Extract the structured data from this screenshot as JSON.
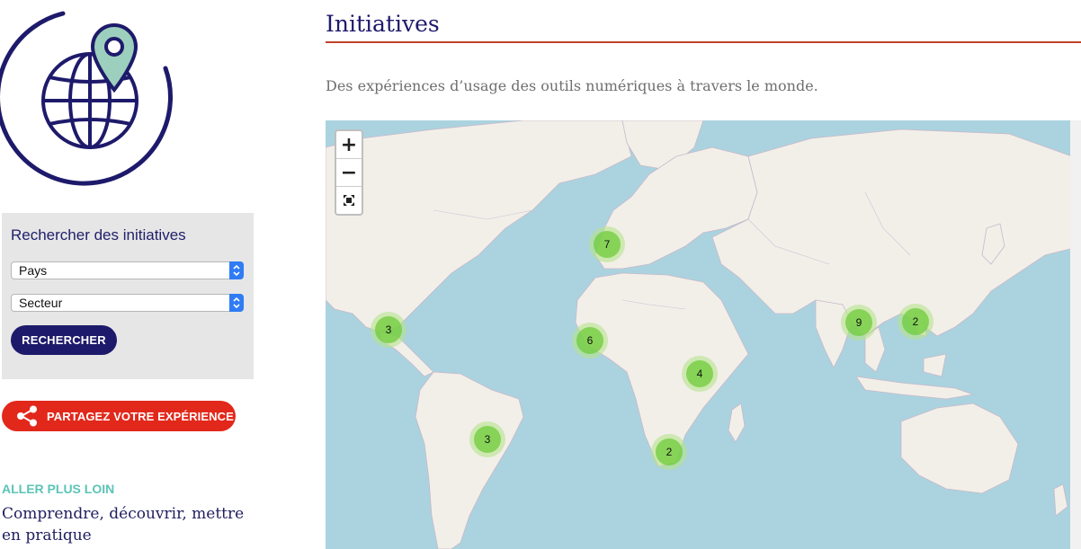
{
  "sidebar": {
    "search": {
      "title": "Rechercher des initiatives",
      "country_select": "Pays",
      "sector_select": "Secteur",
      "search_button": "RECHERCHER"
    },
    "share_button": "PARTAGEZ VOTRE EXPÉRIENCE",
    "go_further": {
      "kicker": "ALLER PLUS LOIN",
      "title": "Comprendre, découvrir, mettre en pratique"
    }
  },
  "main": {
    "title": "Initiatives",
    "intro": "Des expériences d’usage des outils numériques à travers le monde.",
    "map": {
      "zoom_in": "+",
      "zoom_out": "−",
      "clusters": [
        {
          "region": "Central America",
          "count": "3"
        },
        {
          "region": "Western Europe",
          "count": "7"
        },
        {
          "region": "West Africa",
          "count": "6"
        },
        {
          "region": "East Africa",
          "count": "4"
        },
        {
          "region": "Southern Brazil",
          "count": "3"
        },
        {
          "region": "Southern Africa",
          "count": "2"
        },
        {
          "region": "Southeast Asia",
          "count": "9"
        },
        {
          "region": "Philippines",
          "count": "2"
        }
      ]
    }
  },
  "colors": {
    "navy": "#1e1a6b",
    "accent_red": "#e2281b",
    "teal": "#5cc4b7",
    "rule": "#c0432d",
    "ocean": "#aad3df",
    "land": "#f2efe9",
    "cluster": "#6ecc39"
  }
}
